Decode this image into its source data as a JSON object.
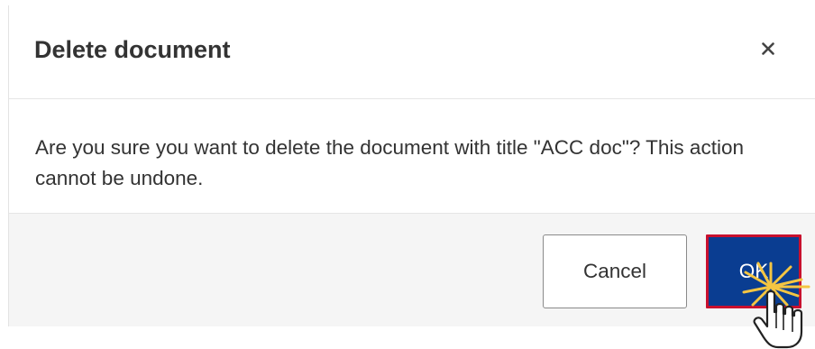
{
  "dialog": {
    "title": "Delete document",
    "close_icon": "close-icon",
    "message": "Are you sure you want to delete the document with title \"ACC doc\"? This action cannot be undone.",
    "buttons": {
      "cancel_label": "Cancel",
      "ok_label": "OK"
    }
  },
  "pointer": {
    "icon": "hand-pointer-icon",
    "effect": "click-burst-icon"
  },
  "colors": {
    "primary": "#0a3d91",
    "highlight_border": "#c8102e",
    "click_burst": "#f4c542",
    "footer_bg": "#f5f5f5",
    "text": "#333333"
  }
}
